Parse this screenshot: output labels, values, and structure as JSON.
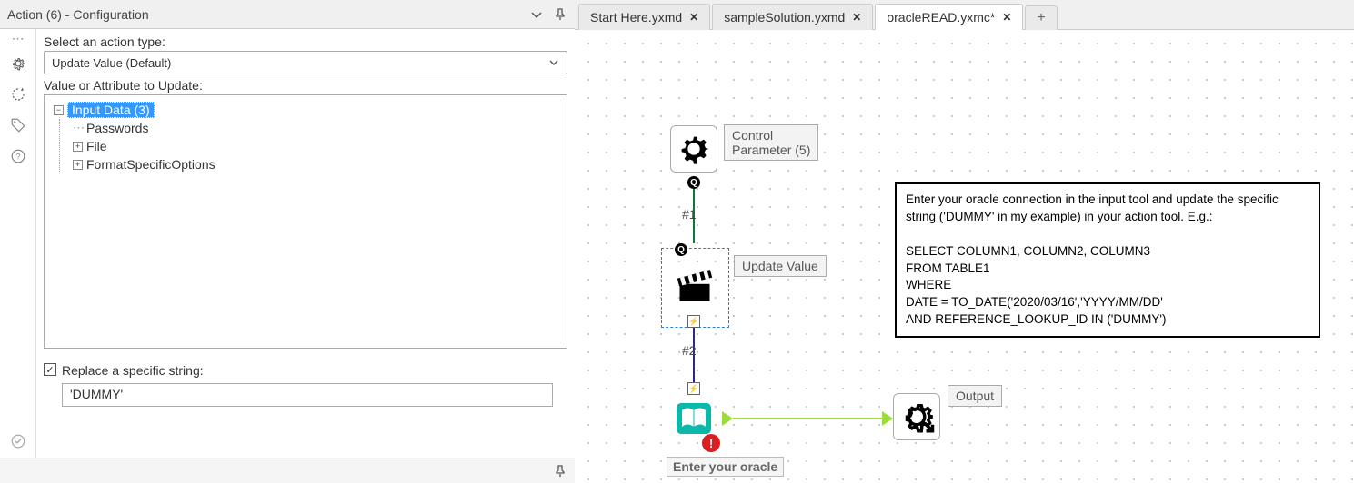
{
  "panel": {
    "title": "Action (6) - Configuration",
    "select_label": "Select an action type:",
    "action_type": "Update Value (Default)",
    "attr_label": "Value or Attribute to Update:",
    "tree": {
      "root": "Input Data (3)",
      "children": [
        "Passwords",
        "File",
        "FormatSpecificOptions"
      ]
    },
    "replace_label": "Replace a specific string:",
    "replace_value": "'DUMMY'"
  },
  "tabs": [
    {
      "label": "Start Here.yxmd",
      "active": false,
      "dirty": false
    },
    {
      "label": "sampleSolution.yxmd",
      "active": false,
      "dirty": false
    },
    {
      "label": "oracleREAD.yxmc*",
      "active": true,
      "dirty": true
    }
  ],
  "canvas": {
    "control_param_label": "Control\nParameter (5)",
    "update_value_label": "Update Value",
    "output_label": "Output",
    "input_label": "Enter your oracle",
    "conn1": "#1",
    "conn2": "#2",
    "comment": "Enter your oracle connection in the input tool and update the specific string ('DUMMY' in my example) in your action tool. E.g.:\n\nSELECT COLUMN1, COLUMN2, COLUMN3\nFROM TABLE1\nWHERE\nDATE = TO_DATE('2020/03/16','YYYY/MM/DD'\nAND REFERENCE_LOOKUP_ID IN ('DUMMY')"
  }
}
